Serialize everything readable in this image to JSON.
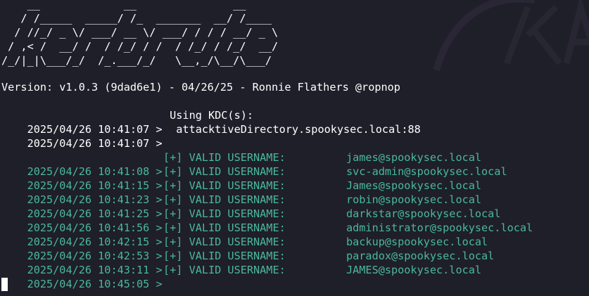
{
  "banner": {
    "art": [
      "    __             __               __     ",
      "   / /_____  _____/ /_  _______  __/ /____ ",
      "  / //_/ _ \\/ ___/ __ \\/ ___/ / / / __/ _ \\",
      " / ,< /  __/ /  / /_/ / /  / /_/ / /_/  __/",
      "/_/|_|\\___/_/  /_.___/_/   \\__,_/\\__/\\___/ "
    ]
  },
  "version_line": "Version: v1.0.3 (9dad6e1) - 04/26/25 - Ronnie Flathers @ropnop",
  "kdc": [
    {
      "timestamp": "2025/04/26 10:41:07 >",
      "text": " Using KDC(s):"
    },
    {
      "timestamp": "2025/04/26 10:41:07 >",
      "text": "  attacktiveDirectory.spookysec.local:88"
    }
  ],
  "results": [
    {
      "timestamp": "2025/04/26 10:41:08 >",
      "status": "[+] VALID USERNAME:",
      "user": "james@spookysec.local"
    },
    {
      "timestamp": "2025/04/26 10:41:15 >",
      "status": "[+] VALID USERNAME:",
      "user": "svc-admin@spookysec.local"
    },
    {
      "timestamp": "2025/04/26 10:41:23 >",
      "status": "[+] VALID USERNAME:",
      "user": "James@spookysec.local"
    },
    {
      "timestamp": "2025/04/26 10:41:25 >",
      "status": "[+] VALID USERNAME:",
      "user": "robin@spookysec.local"
    },
    {
      "timestamp": "2025/04/26 10:41:56 >",
      "status": "[+] VALID USERNAME:",
      "user": "darkstar@spookysec.local"
    },
    {
      "timestamp": "2025/04/26 10:42:15 >",
      "status": "[+] VALID USERNAME:",
      "user": "administrator@spookysec.local"
    },
    {
      "timestamp": "2025/04/26 10:42:53 >",
      "status": "[+] VALID USERNAME:",
      "user": "backup@spookysec.local"
    },
    {
      "timestamp": "2025/04/26 10:43:11 >",
      "status": "[+] VALID USERNAME:",
      "user": "paradox@spookysec.local"
    },
    {
      "timestamp": "2025/04/26 10:45:05 >",
      "status": "[+] VALID USERNAME:",
      "user": "JAMES@spookysec.local"
    }
  ],
  "colors": {
    "background": "#1e1f29",
    "text": "#ffffff",
    "success": "#4bb89a"
  }
}
